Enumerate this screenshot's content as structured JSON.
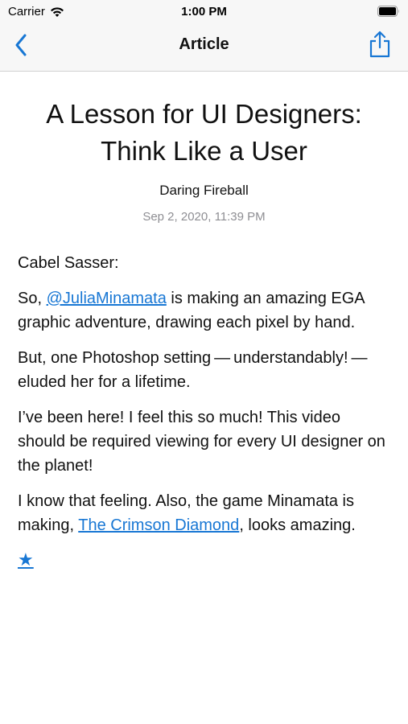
{
  "status_bar": {
    "carrier": "Carrier",
    "time": "1:00 PM"
  },
  "nav": {
    "title": "Article",
    "back_icon": "chevron-left-icon",
    "share_icon": "share-icon",
    "accent_color": "#1877d4"
  },
  "article": {
    "title": "A Lesson for UI Designers: Think Like a User",
    "feed": "Daring Fireball",
    "date": "Sep 2, 2020, 11:39 PM",
    "paragraphs": [
      {
        "text": "Cabel Sasser:"
      },
      {
        "pre": "So, ",
        "link": "@JuliaMinamata",
        "post": " is making an amazing EGA graphic adventure, drawing each pixel by hand."
      },
      {
        "text": "But, one Photoshop setting — understandably! — eluded her for a lifetime."
      },
      {
        "text": "I’ve been here! I feel this so much! This video should be required viewing for every UI designer on the planet!"
      },
      {
        "pre": "I know that feeling. Also, the game Minamata is making, ",
        "link": "The Crimson Diamond",
        "post": ", looks amazing."
      }
    ],
    "star": "★"
  }
}
